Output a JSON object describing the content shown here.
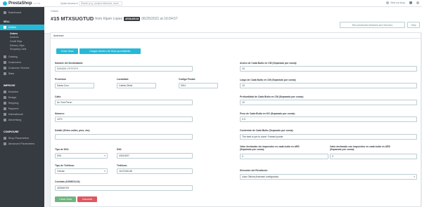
{
  "topbar": {
    "brand": "PrestaShop",
    "version": "1.7.7.8",
    "quick_access": "Quick Access ▾",
    "search_placeholder": "Search (e.g.: product reference, custo",
    "view_shop": "View my shop"
  },
  "sidebar": {
    "dashboard": "Dashboard",
    "sell_section": "SELL",
    "orders": "Orders",
    "orders_sub": [
      "Orders",
      "Invoices",
      "Credit Slips",
      "Delivery Slips",
      "Shopping Carts"
    ],
    "catalog": "Catalog",
    "customers": "Customers",
    "customer_service": "Customer Service",
    "stats": "Stats",
    "improve_section": "IMPROVE",
    "modules": "Modules",
    "design": "Design",
    "shipping": "Shipping",
    "payment": "Payment",
    "international": "International",
    "advertising": "Advertising",
    "configure_section": "CONFIGURE",
    "shop_parameters": "Shop Parameters",
    "advanced_parameters": "Advanced Parameters"
  },
  "header": {
    "breadcrumb": "Orders",
    "order_number": "#15 MTXSUGTUD",
    "from_label": "from Kijam Lopez",
    "total_badge": "ARS6,305.63",
    "date_label": "06/25/2021 at 16:04:57",
    "recommended_btn": "Recommended Modules and Services",
    "help_btn": "Help"
  },
  "panel": {
    "title": "Andreani",
    "btn_crear_guia": "Crear Guía",
    "btn_cargar": "Cargar número de Guía ya existente",
    "btn_crear_guia_bottom": "Crear Guía",
    "btn_cancelar": "Cancelar"
  },
  "form": {
    "nombre_label": "Nombre del Destinatario:",
    "nombre_value": "XXXXXX YYYYYYY",
    "provincia_label": "Provincia:",
    "provincia_value": "Santa Cruz",
    "localidad_label": "Localidad:",
    "localidad_value": "Caleta Olivia",
    "cp_label": "Codigo Postal:",
    "cp_value": "9011",
    "calle_label": "Calle:",
    "calle_value": "Av. Eva Peron",
    "numero_label": "Número:",
    "numero_value": "1073",
    "detalle_label": "Detalle (Entre-calles, piso, etc):",
    "detalle_value": "",
    "tipo_dni_label": "Tipo de DNI:",
    "tipo_dni_value": "DNI",
    "dni_label": "DNI:",
    "dni_value": "43011537",
    "tipo_tel_label": "Tipo de Teléfono:",
    "tipo_tel_value": "Celular",
    "telefono_label": "Teléfono:",
    "telefono_value": "1147245148",
    "contrato_label": "Contrato (DOMICILIO):",
    "contrato_value": "400006709",
    "ancho_label": "Ancho de Cada Bulto en CM (Separado por coma):",
    "ancho_value": "10",
    "largo_label": "Largo de Cada Bulto en CM (Separado por coma):",
    "largo_value": "10",
    "profundidad_label": "Profundidad de Cada Bulto en CM (Separado por coma):",
    "profundidad_value": "10",
    "peso_label": "Peso de Cada Bulto en KG (Separado por coma):",
    "peso_value": "0.3",
    "contenido_label": "Contenido de Cada Bulto (Separado por coma):",
    "contenido_value": "The best is yet to come' Framed poster",
    "valor_sin_label_1": "Valor declarado sin impuestos en cada bulto en ARS",
    "valor_sin_label_2": "(Separado por coma):",
    "valor_sin_value": "0",
    "valor_con_label_1": "Valor declarado con impuestos en cada bulto en ARS",
    "valor_con_label_2": "(Separado por coma):",
    "valor_con_value": "0",
    "direccion_label": "Dirección del Remitente:",
    "direccion_value": "Usar Oficina Andreani configurada"
  }
}
